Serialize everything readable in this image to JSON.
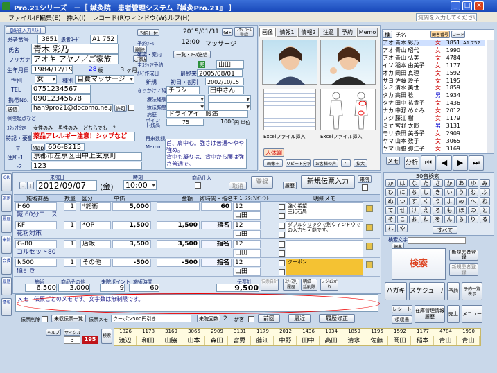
{
  "window": {
    "title": "Pro.21シリーズ　－［ 鍼灸院　患者管理システム『鍼灸Pro.21』 ］",
    "help_placeholder": "質問を入力してください"
  },
  "menu": [
    "ファイル(F)",
    "編集(E)",
    "挿入(I)",
    "レコード(R)",
    "ウィンドウ(W)",
    "ヘルプ(H)"
  ],
  "patient": {
    "blacklist_btn": "【既往入力ﾘｽﾄ】",
    "id_label": "患者番号",
    "id": "3851",
    "code_label": "患者ｺｰﾄﾞ",
    "code": "A1 752",
    "name_label": "氏名",
    "name": "青木 彩乃",
    "kana_label": "フリガナ",
    "kana": "アオキ アヤノ",
    "family": "ご家族",
    "family_btn": "ご家族",
    "delete_btn": "削除",
    "birth_label": "生年月日",
    "birth": "1984/12/19",
    "age": "28",
    "age_unit": "歳",
    "months": "3",
    "months_unit": "ヶ月",
    "sex_label": "性別",
    "sex": "女",
    "type_label": "種別",
    "type": "自費マッサージ",
    "tel_label": "TEL",
    "tel": "0751234567",
    "mobile_label": "携帯No.",
    "mobile": "09012345678",
    "mail_btn": "送信",
    "mail": "han9pro21@docomo.ne.jp",
    "mail_permit": "許可",
    "notes_label": "特記・要望",
    "warning": "薬品アレルギー注意！シップなど",
    "zip_label": "〒",
    "zip_btn": "Map",
    "zip": "606-8215",
    "addr_label": "住所-1",
    "addr1": "京都市左京区田中上玄京町",
    "addr2_label": "-2",
    "addr2": "123",
    "insurance_label": "保険起点など",
    "staff_type_label": "ｽﾀｯﾌ指定",
    "staff_opts": [
      "女性のみ",
      "男性のみ",
      "どちらでも",
      "？"
    ]
  },
  "reservation": {
    "label": "予約日付",
    "date": "2015/01/31",
    "time": "12:00",
    "menu": "マッサージ",
    "gif_btn": "GIF",
    "schedule_btn": "ｽｹｼﾞｭｰﾙ登録",
    "mail_label": "予約ﾒｰﾙ",
    "reason_label": "確認・案内",
    "reason_btn": "一覧・ﾒｰﾙ送信",
    "staff_label": "主ｽﾀｯﾌ/予約",
    "staff_flag": "実",
    "staff": "山田",
    "first_label": "ｶﾙﾃ作成日",
    "first_date": "2005/08/01",
    "last_label": "最終来院",
    "new_label": "新規",
    "first_visit_label": "初日・割引",
    "first_visit": "2002/10/15",
    "referral_label": "きっかけ／紹介",
    "referral": "チラシ",
    "referrer": "田中さん",
    "exp_label": "療法経験",
    "exp2_label": "療法頻度",
    "disease_label": "病歴",
    "disease": "ドライアイ　腰痛",
    "points_label": "ポイント残高",
    "points": "75",
    "price": "1000",
    "price_unit": "円 単位",
    "revisit_label": "再来数額",
    "memo_label": "Memo",
    "memo": "首、肩中心。強さは普通～やや強め。\n背中も凝りは、背中から腰は強さ普通で。"
  },
  "tabs": [
    "画像",
    "情報1",
    "情報2",
    "注意",
    "予約",
    "Memo"
  ],
  "images": {
    "excel1": "Excelファイル挿入",
    "excel2": "Excelファイル挿入",
    "body_label": "人体図",
    "btn1": "画像＋",
    "btn2": "リピート分析",
    "btn3": "お客様の声",
    "btn4": "？",
    "btn5": "拡大"
  },
  "visit": {
    "date_label": "来院日",
    "date": "2012/09/07",
    "dow": "金",
    "time_label": "時刻",
    "time": "10:00",
    "goods_label": "商品仕入",
    "cancel_btn": "取消",
    "register_btn": "登録",
    "history_btn": "履歴",
    "new_btn": "新規伝票入力",
    "home_btn": "来院",
    "col_treat": "施術商品",
    "col_qty": "数量",
    "col_unit": "区分",
    "col_price": "単価",
    "col_amount": "金額",
    "col_staff": "術時間・指名",
    "col_staff_b": "主 1",
    "col_point": "ｽﾀｯﾌ/ﾎﾟｲﾝﾄ",
    "col_memo": "明細メモ",
    "rows": [
      {
        "code": "H60",
        "name": "鍼 60分コース",
        "qty": "1",
        "unit": "*施術",
        "price": "5,000",
        "amount": "",
        "time": "60",
        "min": "12",
        "staff": "山田",
        "memo": "強く希望\n主に右肩"
      },
      {
        "code": "KF",
        "name": "花粉対策",
        "qty": "1",
        "unit": "*OP",
        "price": "1,500",
        "amount": "1,500",
        "time": "指名",
        "min": "12",
        "staff": "山田",
        "memo": "ダブルクリックで別ウィンドウでの入力も可能です。"
      },
      {
        "code": "G-80",
        "name": "コルセット80",
        "qty": "1",
        "unit": "店販",
        "price": "3,500",
        "amount": "3,500",
        "time": "指名",
        "min": "12",
        "staff": "山田",
        "memo": ""
      },
      {
        "code": "N500",
        "name": "値引き",
        "qty": "1",
        "unit": "その他",
        "price": "-500",
        "amount": "-500",
        "time": "指名",
        "min": "12",
        "staff": "山田",
        "memo": "クーポン"
      }
    ],
    "sum_treat_label": "施術",
    "sum_treat": "6,500",
    "sum_goods_label": "商品その他",
    "sum_goods": "3,000",
    "sum_point_label": "来院ポイント",
    "sum_point": "9",
    "sum_time_label": "施術時間",
    "sum_time": "60",
    "total_label": "伝票計",
    "total": "9,500",
    "tax_label": "伝票自計",
    "staff_btn": "ｽﾀｯﾌ別履歴",
    "memo_btn": "明細一括削除",
    "receipt_btn": "レジおかり",
    "memo": "メモ　伝票ごとのメモです。文字数は無制限です。",
    "slip_delete": "伝票削除",
    "unpaid_btn": "未収伝票一覧",
    "coupon_label": "伝票メモ",
    "coupon": "クーポン500円引き",
    "count_label": "来院回数",
    "count": "2",
    "new_label": "新客",
    "prev_btn": "前回",
    "next_btn": "最近",
    "history_btn2": "履歴修正"
  },
  "patient_list": {
    "search_label": "検",
    "name_col": "氏名",
    "code_btn": "顧客番号",
    "code2_btn": "コード",
    "rows": [
      {
        "k": "アオ",
        "n": "青木 彩乃",
        "s": "女",
        "num": "3851",
        "c": "A1 752"
      },
      {
        "k": "アオ",
        "n": "青山 昭代",
        "s": "女",
        "num": "1990",
        "c": ""
      },
      {
        "k": "アオ",
        "n": "青山 弘美",
        "s": "女",
        "num": "4784",
        "c": ""
      },
      {
        "k": "イソ",
        "n": "稲本 由美子",
        "s": "女",
        "num": "1177",
        "c": ""
      },
      {
        "k": "オカ",
        "n": "岡田 真理",
        "s": "女",
        "num": "1592",
        "c": ""
      },
      {
        "k": "サヨ",
        "n": "佐藤 玲子",
        "s": "女",
        "num": "1195",
        "c": ""
      },
      {
        "k": "シミ",
        "n": "清水 美世",
        "s": "女",
        "num": "1859",
        "c": ""
      },
      {
        "k": "タカ",
        "n": "高田 稔",
        "s": "男",
        "num": "1934",
        "c": ""
      },
      {
        "k": "タナ",
        "n": "田中 祐貴子",
        "s": "女",
        "num": "1436",
        "c": ""
      },
      {
        "k": "ナカ",
        "n": "中野 めぐみ",
        "s": "女",
        "num": "2012",
        "c": ""
      },
      {
        "k": "フジ",
        "n": "藤江 樹",
        "s": "女",
        "num": "1179",
        "c": ""
      },
      {
        "k": "ミヤ",
        "n": "宮野 太郎",
        "s": "男",
        "num": "3131",
        "c": ""
      },
      {
        "k": "モリ",
        "n": "森田 美香子",
        "s": "女",
        "num": "2909",
        "c": ""
      },
      {
        "k": "ヤマ",
        "n": "山本 数子",
        "s": "女",
        "num": "3065",
        "c": ""
      },
      {
        "k": "ヤマ",
        "n": "山脇 弥江子",
        "s": "女",
        "num": "3169",
        "c": ""
      }
    ],
    "memo_btn": "メモ",
    "analysis_btn": "分析",
    "kana_title": "50音検索",
    "all_btn": "すべて",
    "search_btn": "検索",
    "kana_field_label": "検索文字",
    "list_btn": "顧客",
    "new_btn": "新規患者登録",
    "new_btn2": "新規患者登録",
    "hagaki": "ハガキ",
    "schedule": "スケジュール",
    "nav1": "予約",
    "nav2": "予約一覧表示",
    "receipt": "レシート",
    "receipt2": "領収書",
    "records": "在庫管理情報履歴",
    "cash": "売上",
    "menu": "メニュー",
    "list2": "顧客"
  },
  "kana": [
    "か",
    "は",
    "な",
    "た",
    "さ",
    "か",
    "あ",
    "ゆ",
    "み",
    "ひ",
    "に",
    "ち",
    "し",
    "き",
    "い",
    "う",
    "む",
    "ふ",
    "ぬ",
    "つ",
    "す",
    "く",
    "う",
    "よ",
    "め",
    "へ",
    "ね",
    "て",
    "せ",
    "け",
    "え",
    "ろ",
    "も",
    "ほ",
    "の",
    "と",
    "そ",
    "こ",
    "お",
    "わ",
    "を",
    "ん",
    "ら",
    "り",
    "る",
    "れ",
    "や"
  ],
  "left_nav": [
    "QR",
    "施術",
    "履歴",
    "来院",
    "会員",
    "履歴",
    "情報"
  ],
  "bottom": {
    "help_btn": "ヘルプ",
    "cycle_label": "サイクル",
    "cycle": "3",
    "count": "195",
    "date_label": "来院日",
    "staff_label": "検索",
    "recent": [
      {
        "n": "1826",
        "name": "渡辺"
      },
      {
        "n": "1178",
        "name": "和田"
      },
      {
        "n": "3169",
        "name": "山脇"
      },
      {
        "n": "3065",
        "name": "山本"
      },
      {
        "n": "2909",
        "name": "森田"
      },
      {
        "n": "3131",
        "name": "宮野"
      },
      {
        "n": "1179",
        "name": "藤江"
      },
      {
        "n": "2012",
        "name": "中野"
      },
      {
        "n": "1436",
        "name": "田中"
      },
      {
        "n": "1934",
        "name": "高田"
      },
      {
        "n": "1859",
        "name": "清水"
      },
      {
        "n": "1195",
        "name": "佐藤"
      },
      {
        "n": "1592",
        "name": "岡田"
      },
      {
        "n": "1177",
        "name": "稲本"
      },
      {
        "n": "4784",
        "name": "青山"
      },
      {
        "n": "1990",
        "name": "青山"
      }
    ]
  }
}
